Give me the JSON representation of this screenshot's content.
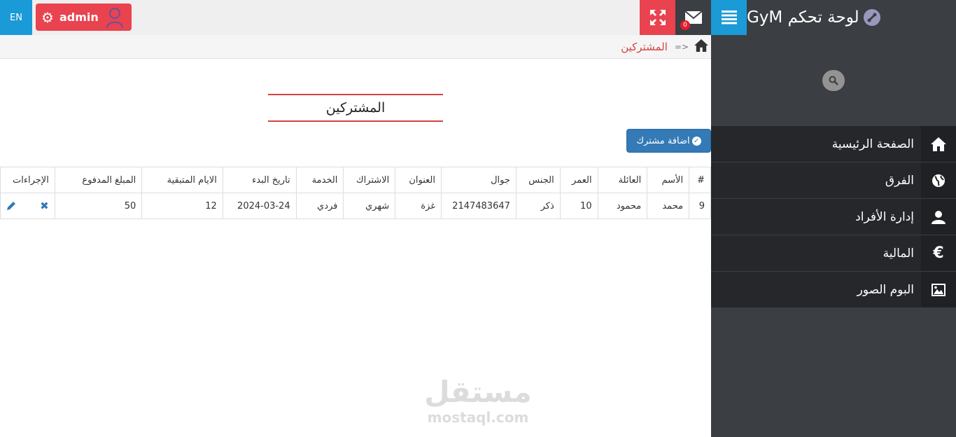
{
  "header": {
    "lang_label": "EN",
    "admin_label": "admin",
    "mail_badge": "0",
    "brand_title": "لوحة تحكم GyM"
  },
  "sidebar": {
    "items": [
      {
        "label": "الصفحة الرئيسية",
        "icon": "home-icon"
      },
      {
        "label": "الفرق",
        "icon": "globe-icon"
      },
      {
        "label": "إدارة الأفراد",
        "icon": "user-icon"
      },
      {
        "label": "المالية",
        "icon": "euro-icon"
      },
      {
        "label": "البوم الصور",
        "icon": "picture-icon"
      }
    ]
  },
  "breadcrumb": {
    "separator": "=>",
    "current": "المشتركين"
  },
  "main": {
    "title": "المشتركين",
    "add_button": "اضافة مشترك"
  },
  "table": {
    "headers": [
      "#",
      "الأسم",
      "العائلة",
      "العمر",
      "الجنس",
      "جوال",
      "العنوان",
      "الاشتراك",
      "الخدمة",
      "تاريخ البدء",
      "الايام المتبقية",
      "المبلغ المدفوع",
      "الإجراءات"
    ],
    "rows": [
      [
        "9",
        "محمد",
        "محمود",
        "10",
        "ذكر",
        "2147483647",
        "غزة",
        "شهري",
        "فردي",
        "2024-03-24",
        "12",
        "50"
      ]
    ]
  },
  "watermark": {
    "arabic": "مستقل",
    "latin": "mostaql.com"
  },
  "colors": {
    "accent_red": "#e8434f",
    "accent_blue": "#1a9ad6",
    "sidebar_dark": "#3b3e43"
  }
}
